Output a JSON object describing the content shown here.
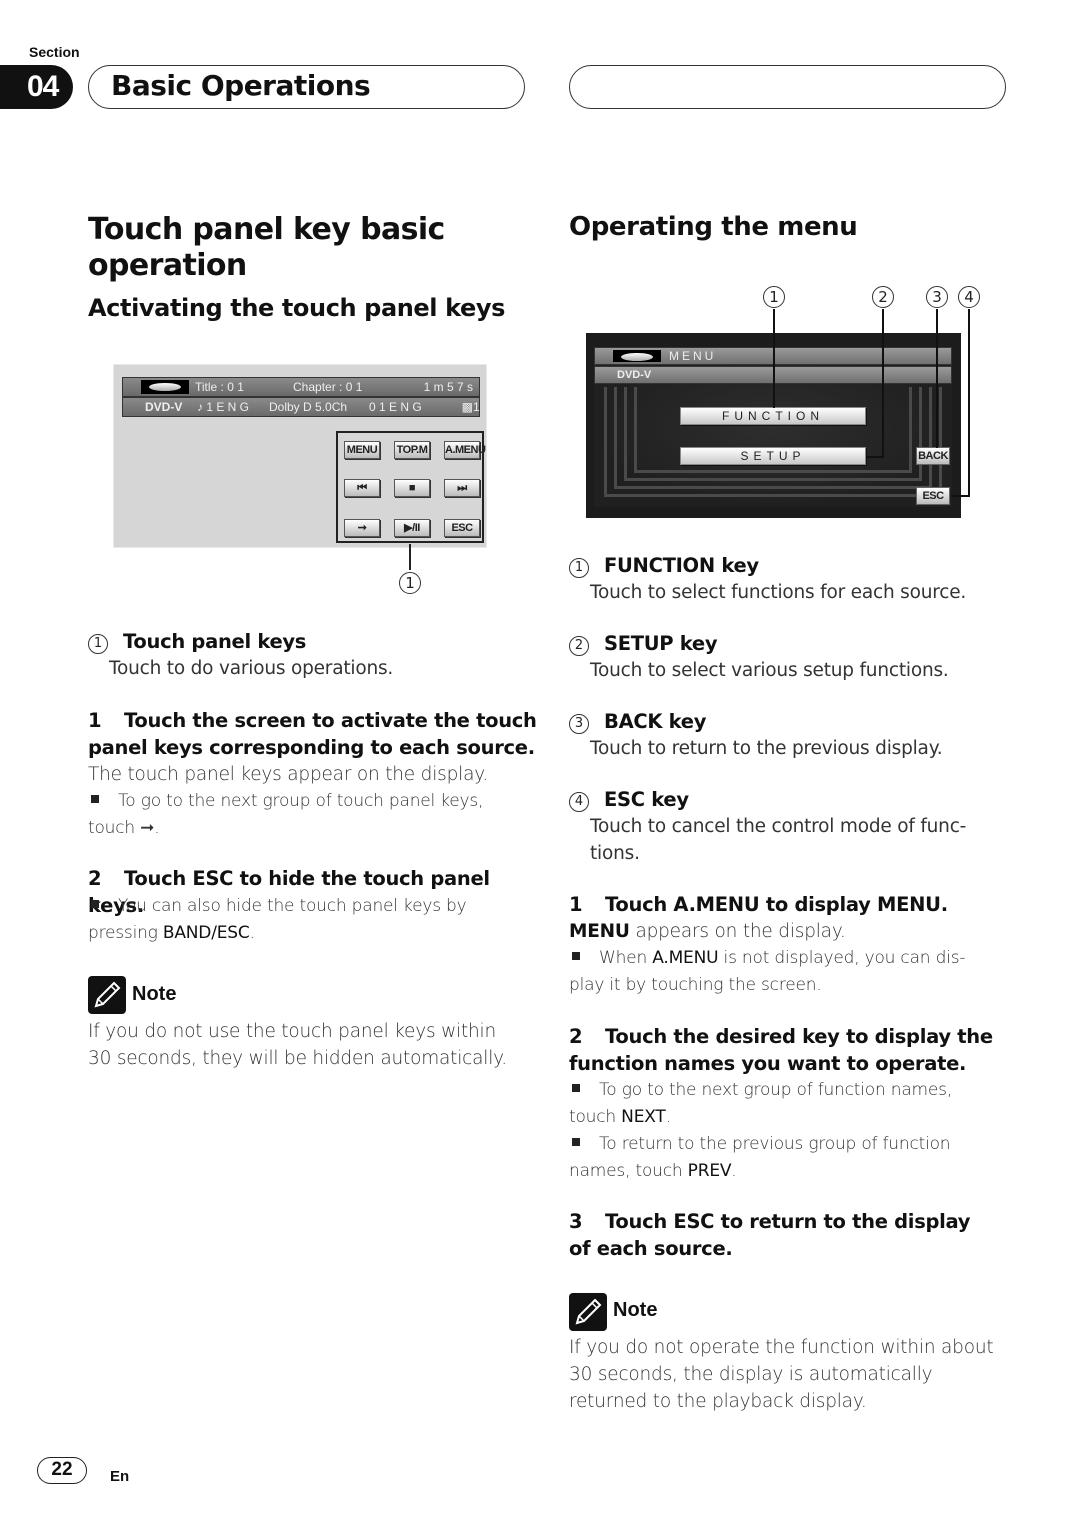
{
  "header": {
    "section_label": "Section",
    "section_number": "04",
    "section_title": "Basic Operations"
  },
  "left": {
    "title": "Touch panel key basic operation",
    "subtitle": "Activating the touch panel keys",
    "screen": {
      "bar1": {
        "title": "Title : 0 1",
        "chapter": "Chapter : 0 1",
        "time": "1 m 5 7 s"
      },
      "bar2": {
        "source": "DVD-V",
        "audio": "♪ 1 E N G",
        "format": "Dolby D 5.0Ch",
        "subtitle": "0 1 E N G",
        "angle": "1"
      },
      "keys": [
        [
          "MENU",
          "TOP.M",
          "A.MENU"
        ],
        [
          "⏮",
          "■",
          "⏭"
        ],
        [
          "➞",
          "▶/II",
          "ESC"
        ]
      ],
      "callout_marker": "1"
    },
    "callouts": [
      {
        "marker": "1",
        "label": "Touch panel keys",
        "desc": "Touch to do various operations."
      }
    ],
    "step1": {
      "num": "1",
      "title": "Touch the screen to activate the touch panel keys corresponding to each source.",
      "body": "The touch panel keys appear on the display.",
      "bullet": "To go to the next group of touch panel keys, touch ➞."
    },
    "step2": {
      "num": "2",
      "title": "Touch ESC to hide the touch panel keys.",
      "bullet_pre": "You can also hide the touch panel keys by pressing ",
      "bullet_bold": "BAND/ESC",
      "bullet_post": "."
    },
    "note": {
      "label": "Note",
      "text": "If you do not use the touch panel keys within 30 seconds, they will be hidden automatically."
    }
  },
  "right": {
    "title": "Operating the menu",
    "screen": {
      "markers": [
        "1",
        "2",
        "3",
        "4"
      ],
      "menu_title": "MENU",
      "source": "DVD-V",
      "function_button": "FUNCTION",
      "setup_button": "SETUP",
      "back_button": "BACK",
      "esc_button": "ESC"
    },
    "callouts": [
      {
        "marker": "1",
        "label": "FUNCTION key",
        "desc": "Touch to select functions for each source."
      },
      {
        "marker": "2",
        "label": "SETUP key",
        "desc": "Touch to select various setup functions."
      },
      {
        "marker": "3",
        "label": "BACK key",
        "desc": "Touch to return to the previous display."
      },
      {
        "marker": "4",
        "label": "ESC key",
        "desc": "Touch to cancel the control mode of func- tions."
      }
    ],
    "step1": {
      "num": "1",
      "title": "Touch A.MENU to display MENU.",
      "body_bold": "MENU",
      "body": " appears on the display.",
      "bullet_pre": "When ",
      "bullet_bold": "A.MENU",
      "bullet_post": " is not displayed, you can dis- play it by touching the screen."
    },
    "step2": {
      "num": "2",
      "title": "Touch the desired key to display the function names you want to operate.",
      "bullet1_pre": "To go to the next group of function names, touch ",
      "bullet1_bold": "NEXT",
      "bullet1_post": ".",
      "bullet2_pre": "To return to the previous group of function names, touch ",
      "bullet2_bold": "PREV",
      "bullet2_post": "."
    },
    "step3": {
      "num": "3",
      "title": "Touch ESC to return to the display of each source."
    },
    "note": {
      "label": "Note",
      "text": "If you do not operate the function within about 30 seconds, the display is automatically returned to the playback display."
    }
  },
  "footer": {
    "page_number": "22",
    "language": "En"
  }
}
